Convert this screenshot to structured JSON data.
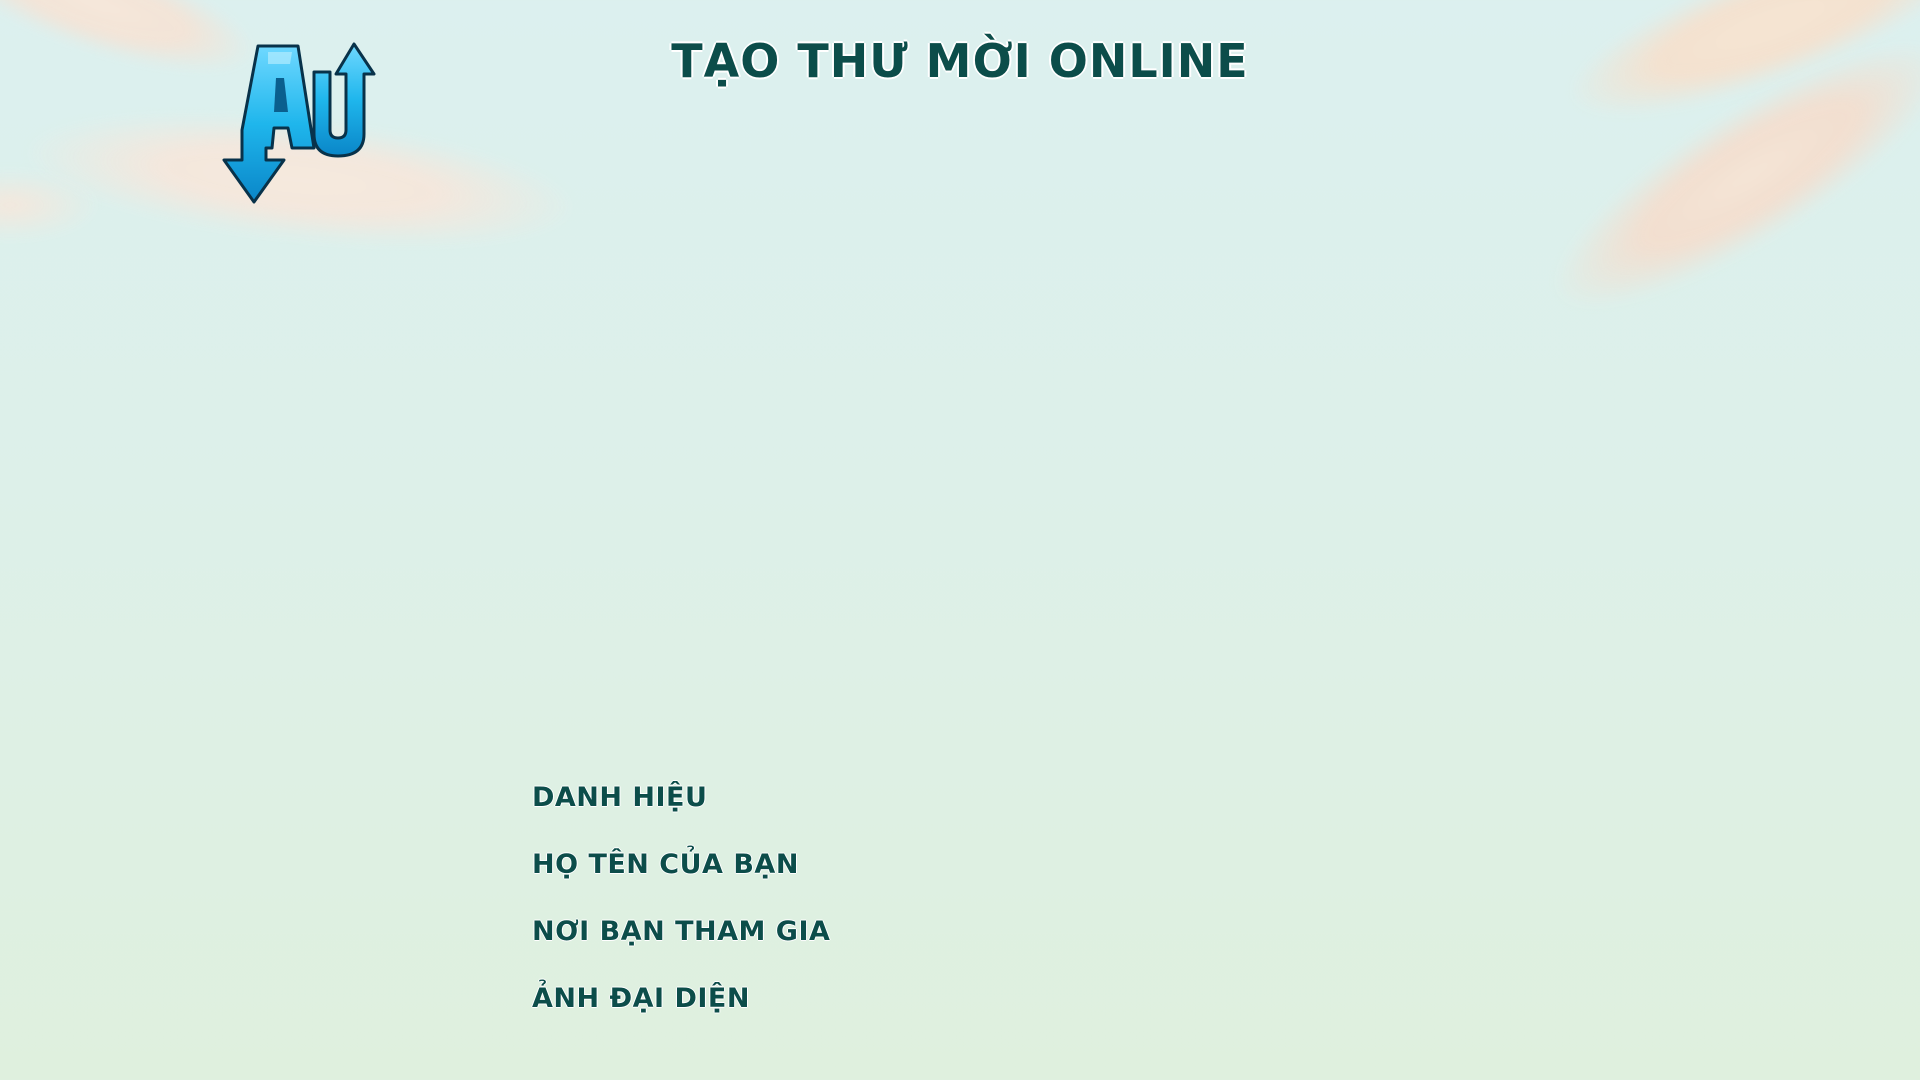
{
  "page": {
    "title": "TẠO THƯ MỜI ONLINE",
    "logo_icon": "au-arrows-logo-icon"
  },
  "form": {
    "fields": [
      {
        "label": "DANH HIỆU"
      },
      {
        "label": "HỌ TÊN CỦA BẠN"
      },
      {
        "label": "NƠI BẠN THAM GIA"
      },
      {
        "label": "ẢNH ĐẠI DIỆN"
      }
    ]
  },
  "colors": {
    "title": "#0c4d4a",
    "logo_blue": "#1fb6ec",
    "background_top": "#dcf0ef",
    "background_bottom": "#dff0de"
  }
}
